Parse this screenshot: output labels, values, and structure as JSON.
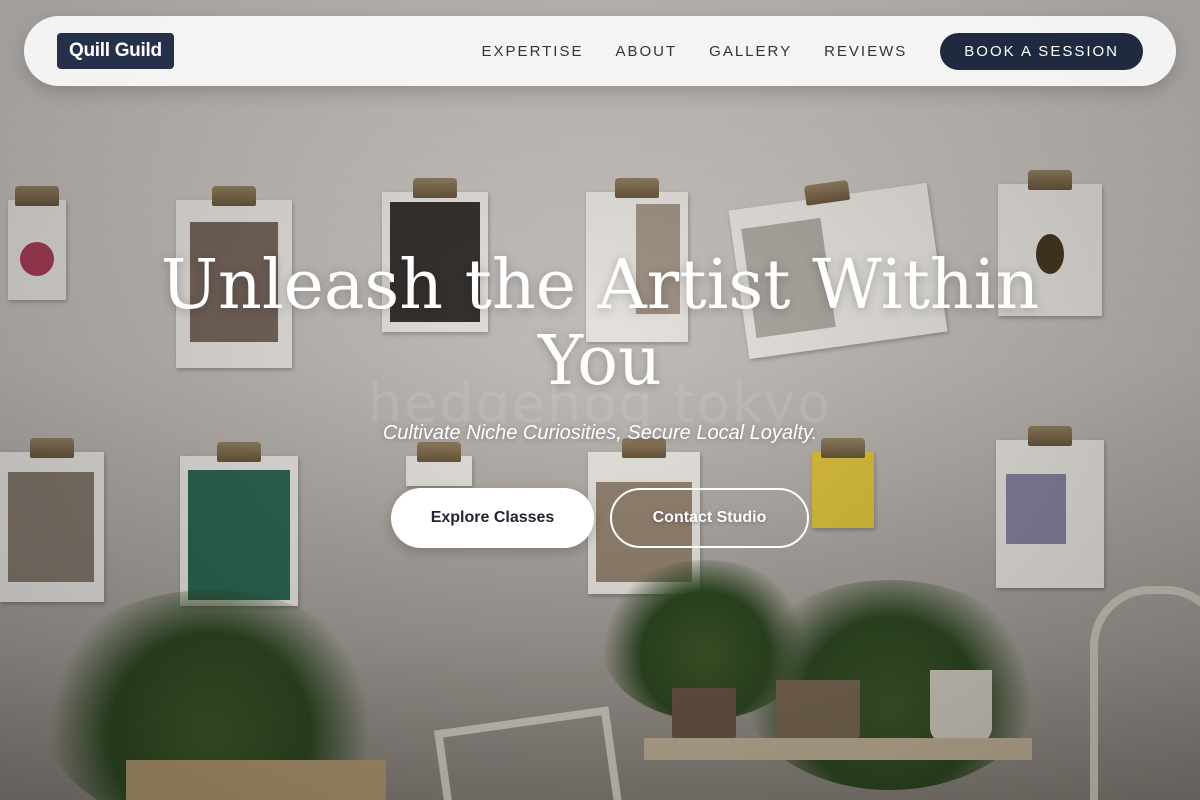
{
  "brand": {
    "name": "Quill Guild"
  },
  "nav": {
    "links": [
      {
        "label": "EXPERTISE"
      },
      {
        "label": "ABOUT"
      },
      {
        "label": "GALLERY"
      },
      {
        "label": "REVIEWS"
      }
    ],
    "cta_label": "BOOK A SESSION"
  },
  "hero": {
    "title": "Unleash the Artist Within You",
    "subtitle": "Cultivate Niche Curiosities, Secure Local Loyalty.",
    "primary_button": "Explore Classes",
    "secondary_button": "Contact Studio",
    "background_watermark": "hedgehog tokyo"
  },
  "colors": {
    "brand_navy": "#25304a",
    "cta_navy": "#1f2a40",
    "nav_bg": "#f8f8f8",
    "hero_text": "#ffffff"
  }
}
